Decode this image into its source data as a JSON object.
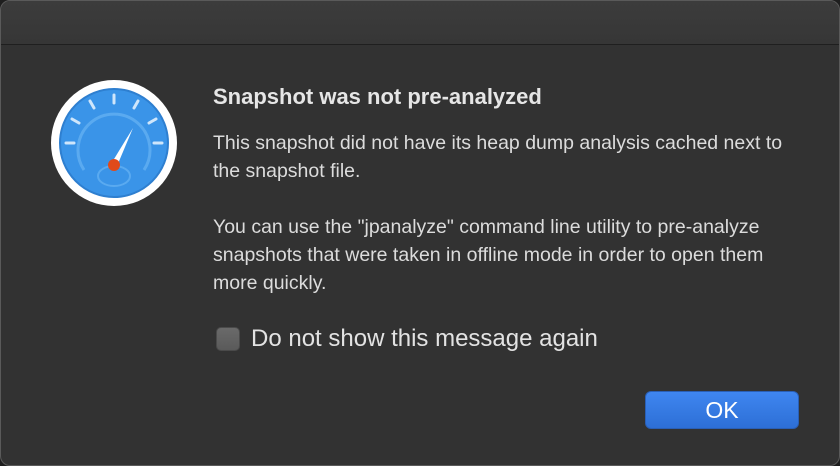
{
  "dialog": {
    "title": "Snapshot was not pre-analyzed",
    "paragraph_1": "This snapshot did not have its heap dump analysis cached next to the snapshot file.",
    "paragraph_2": "You can use the \"jpanalyze\" command line utility to pre-analyze snapshots that were taken in offline mode in order to open them more quickly.",
    "checkbox_label": "Do not show this message again",
    "checkbox_checked": false,
    "ok_label": "OK"
  },
  "icon": {
    "name": "speedometer-icon",
    "colors": {
      "rim": "#ffffff",
      "face": "#3a94e8",
      "needle": "#ffffff",
      "hub": "#e04a1a"
    }
  },
  "colors": {
    "window_bg": "#323232",
    "accent": "#2f74e0"
  }
}
